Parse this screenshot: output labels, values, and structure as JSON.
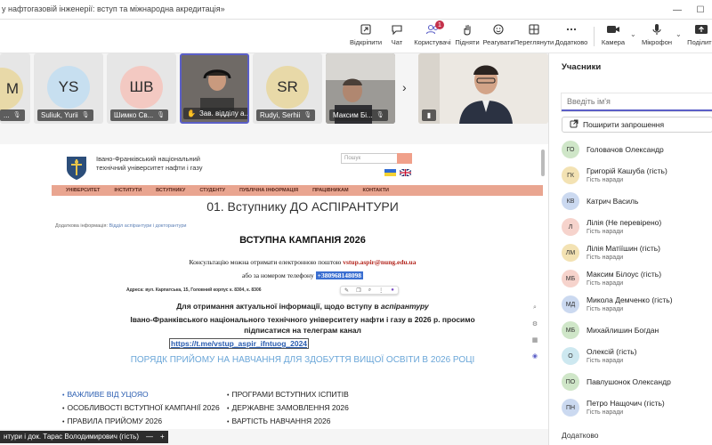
{
  "window": {
    "title": "у нафтогазовій інженерії: вступ та міжнародна акредитація»"
  },
  "toolbar": {
    "items": [
      {
        "label": "Відкріпити",
        "icon": "unpin-icon"
      },
      {
        "label": "Чат",
        "icon": "chat-icon"
      },
      {
        "label": "Користувачі",
        "icon": "people-icon",
        "badge": "1"
      },
      {
        "label": "Підняти",
        "icon": "raise-hand-icon"
      },
      {
        "label": "Реагувати",
        "icon": "react-icon"
      },
      {
        "label": "Переглянути",
        "icon": "view-icon"
      },
      {
        "label": "Додатково",
        "icon": "more-icon"
      },
      {
        "label": "Камера",
        "icon": "camera-icon"
      },
      {
        "label": "Мікрофон",
        "icon": "mic-icon"
      },
      {
        "label": "Поділити",
        "icon": "share-icon"
      }
    ]
  },
  "strip": {
    "tiles": [
      {
        "initials": "M",
        "name": "",
        "color": "#e8d9a8"
      },
      {
        "initials": "YS",
        "name": "Suliuk, Yurii",
        "color": "#c7dff0"
      },
      {
        "initials": "ШВ",
        "name": "Шимко Св...",
        "color": "#f3c9c2"
      },
      {
        "initials": "",
        "name": "Зав. відділу а...",
        "color": "#9a9a9a"
      },
      {
        "initials": "SR",
        "name": "Rudyi, Serhii",
        "color": "#e8d9a8"
      },
      {
        "initials": "",
        "name": "Максим Бі...",
        "color": "#8a8a8a"
      }
    ]
  },
  "site": {
    "name": "Івано-Франківський національний технічний університет нафти і газу",
    "search_placeholder": "Пошук",
    "nav": [
      "УНІВЕРСИТЕТ",
      "ІНСТИТУТИ",
      "ВСТУПНИКУ",
      "СТУДЕНТУ",
      "ПУБЛІЧНА ІНФОРМАЦІЯ",
      "ПРАЦІВНИКАМ",
      "КОНТАКТИ"
    ],
    "h1": "01. Вступнику ДО АСПІРАНТУРИ",
    "sub_info_label": "Додаткова інформація:",
    "sub_info_link": "Відділ аспірантури і докторантури",
    "campaign": "ВСТУПНА КАМПАНІЯ 2026",
    "consult_prefix": "Консультацію можна отримати електронною поштою",
    "consult_email": "vstup.aspir@nung.edu.ua",
    "phone_prefix": "або за номером телефону",
    "phone": "+380968148098",
    "address": "Адреса: вул. Карпатська, 15, Головний корпус к. 8304, к. 8306",
    "actual_prefix": "Для отримання актуальної інформації, щодо вступу в",
    "actual_italic": "аспірантуру",
    "uni_line": "Івано-Франківського національного технічного університету нафти і газу в 2026 р.  просимо",
    "uni_line2": "підписатися на телеграм канал",
    "tg_link": "https://t.me/vstup_aspir_ifntuog_2024",
    "order": "ПОРЯДК ПРИЙОМУ НА НАВЧАННЯ ДЛЯ ЗДОБУТТЯ ВИЩОЇ ОСВІТИ В 2026 РОЦІ",
    "links_left": [
      "ВАЖЛИВЕ ВІД УЦОЯО",
      "ОСОБЛИВОСТІ ВСТУПНОЇ КАМПАНІЇ 2026",
      "ПРАВИЛА ПРИЙОМУ 2026"
    ],
    "links_right": [
      "ПРОГРАМИ ВСТУПНИХ ІСПИТІВ",
      "ДЕРЖАВНЕ ЗАМОВЛЕННЯ 2026",
      "ВАРТІСТЬ НАВЧАННЯ 2026"
    ]
  },
  "presenter": {
    "label": "нтури і док. Тарас Володимирович (гість)"
  },
  "panel": {
    "title": "Учасники",
    "search_placeholder": "Введіть ім'я",
    "invite_label": "Поширити запрошення",
    "people": [
      {
        "initials": "ГО",
        "name": "Головачов Олександр",
        "role": "",
        "color": "#cfe6c8"
      },
      {
        "initials": "ГК",
        "name": "Григорій Кашуба (гість)",
        "role": "Гість наради",
        "color": "#f3e2b3"
      },
      {
        "initials": "КВ",
        "name": "Катрич Василь",
        "role": "",
        "color": "#cbd9f0"
      },
      {
        "initials": "Л",
        "name": "Лілія (Не перевірено)",
        "role": "Гість наради",
        "color": "#f6d3cc"
      },
      {
        "initials": "ЛМ",
        "name": "Лілія Матіїшин (гість)",
        "role": "Гість наради",
        "color": "#f3e2b3"
      },
      {
        "initials": "МБ",
        "name": "Максим Білоус (гість)",
        "role": "Гість наради",
        "color": "#f6d3cc"
      },
      {
        "initials": "МД",
        "name": "Микола Демченко (гість)",
        "role": "Гість наради",
        "color": "#cbd9f0"
      },
      {
        "initials": "МБ",
        "name": "Михайлишин Богдан",
        "role": "",
        "color": "#cfe6c8"
      },
      {
        "initials": "О",
        "name": "Олексій (гість)",
        "role": "Гість наради",
        "color": "#cde8f0"
      },
      {
        "initials": "ПО",
        "name": "Павлушонок Олександр",
        "role": "",
        "color": "#cfe6c8"
      },
      {
        "initials": "ПН",
        "name": "Петро Нащочич (гість)",
        "role": "Гість наради",
        "color": "#cbd9f0"
      }
    ],
    "more_label": "Додатково"
  }
}
